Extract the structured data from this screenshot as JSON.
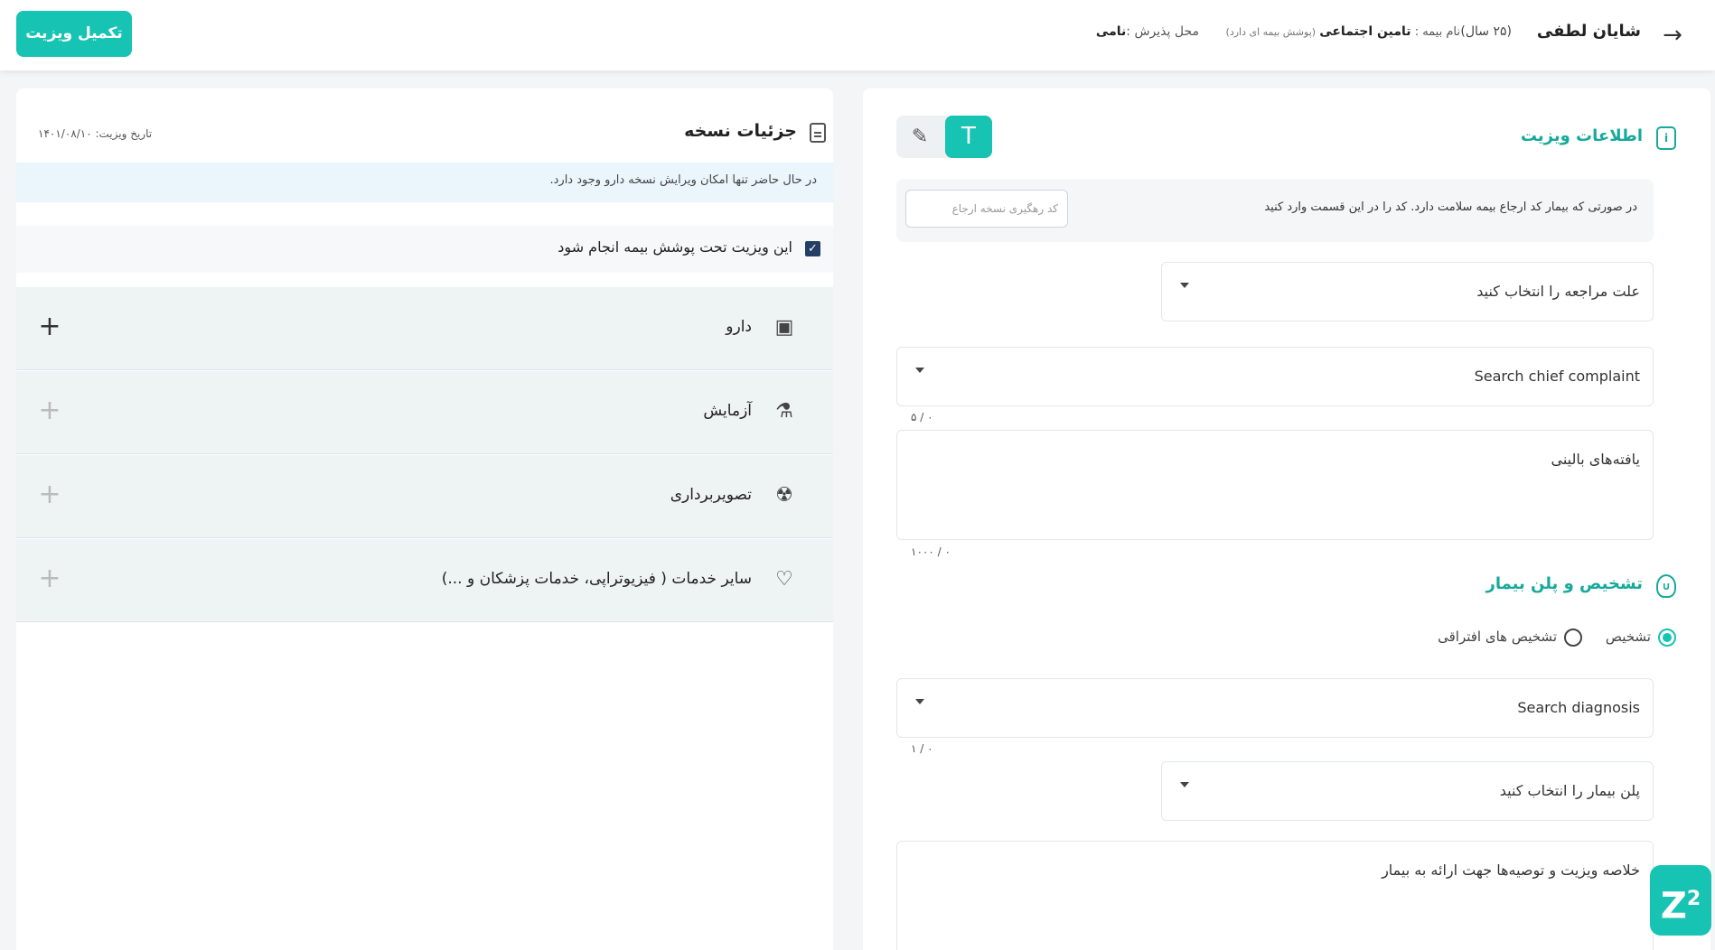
{
  "header": {
    "back_icon": "arrow-right-icon",
    "patient_name": "شایان لطفی",
    "patient_age": "(۲۵ سال)",
    "insurance_label": "نام بیمه :",
    "insurance_name": "تامین اجتماعی",
    "insurance_note": "(پوشش بیمه ای دارد)",
    "location_label": "محل پذیرش :",
    "location_value": "نامی",
    "finish_button": "تکمیل ویزیت"
  },
  "prescription": {
    "title": "جزئیات نسخه",
    "title_icon": "document-icon",
    "visit_date": "تاریخ ویزیت: ۱۴۰۱/۰۸/۱۰",
    "notice": "در حال حاضر تنها امکان ویرایش نسخه دارو وجود دارد.",
    "insurance_checkbox_label": "این ویزیت تحت پوشش بیمه انجام شود",
    "insurance_checked": true,
    "services": [
      {
        "label": "دارو",
        "icon": "pill-bottle-icon",
        "enabled": true
      },
      {
        "label": "آزمایش",
        "icon": "flask-icon",
        "enabled": false
      },
      {
        "label": "تصویربرداری",
        "icon": "radiation-icon",
        "enabled": false
      },
      {
        "label": "سایر خدمات ( فیزیوتراپی، خدمات پزشکان و ...)",
        "icon": "heart-pulse-icon",
        "enabled": false
      }
    ]
  },
  "visit_info": {
    "title": "اطلاعات ویزیت",
    "title_icon": "info-icon",
    "text_mode_icon": "text-icon",
    "handwrite_mode_icon": "pen-icon",
    "referral_text": "در صورتی که بیمار کد ارجاع بیمه سلامت دارد. کد را در این قسمت وارد کنید",
    "referral_placeholder": "کد رهگیری نسخه ارجاع",
    "visit_reason": "علت مراجعه را انتخاب کنید",
    "chief_complaint": "Search chief complaint",
    "chief_complaint_counter": "۰ / ۵",
    "clinical_findings": "یافته‌های بالینی",
    "clinical_findings_counter": "۰ / ۱۰۰۰"
  },
  "diagnosis": {
    "title": "تشخیص و پلن بیمار",
    "title_icon": "stethoscope-icon",
    "radio_diagnosis": "تشخیص",
    "radio_differential": "تشخیص های افتراقی",
    "selected": "diagnosis",
    "search": "Search diagnosis",
    "search_counter": "۰ / ۱",
    "plan": "پلن بیمار را انتخاب کنید",
    "summary": "خلاصه ویزیت و توصیه‌ها جهت ارائه به بیمار"
  },
  "colors": {
    "accent": "#17c3b2",
    "accent_text": "#17a99b",
    "checkbox": "#243f66"
  }
}
